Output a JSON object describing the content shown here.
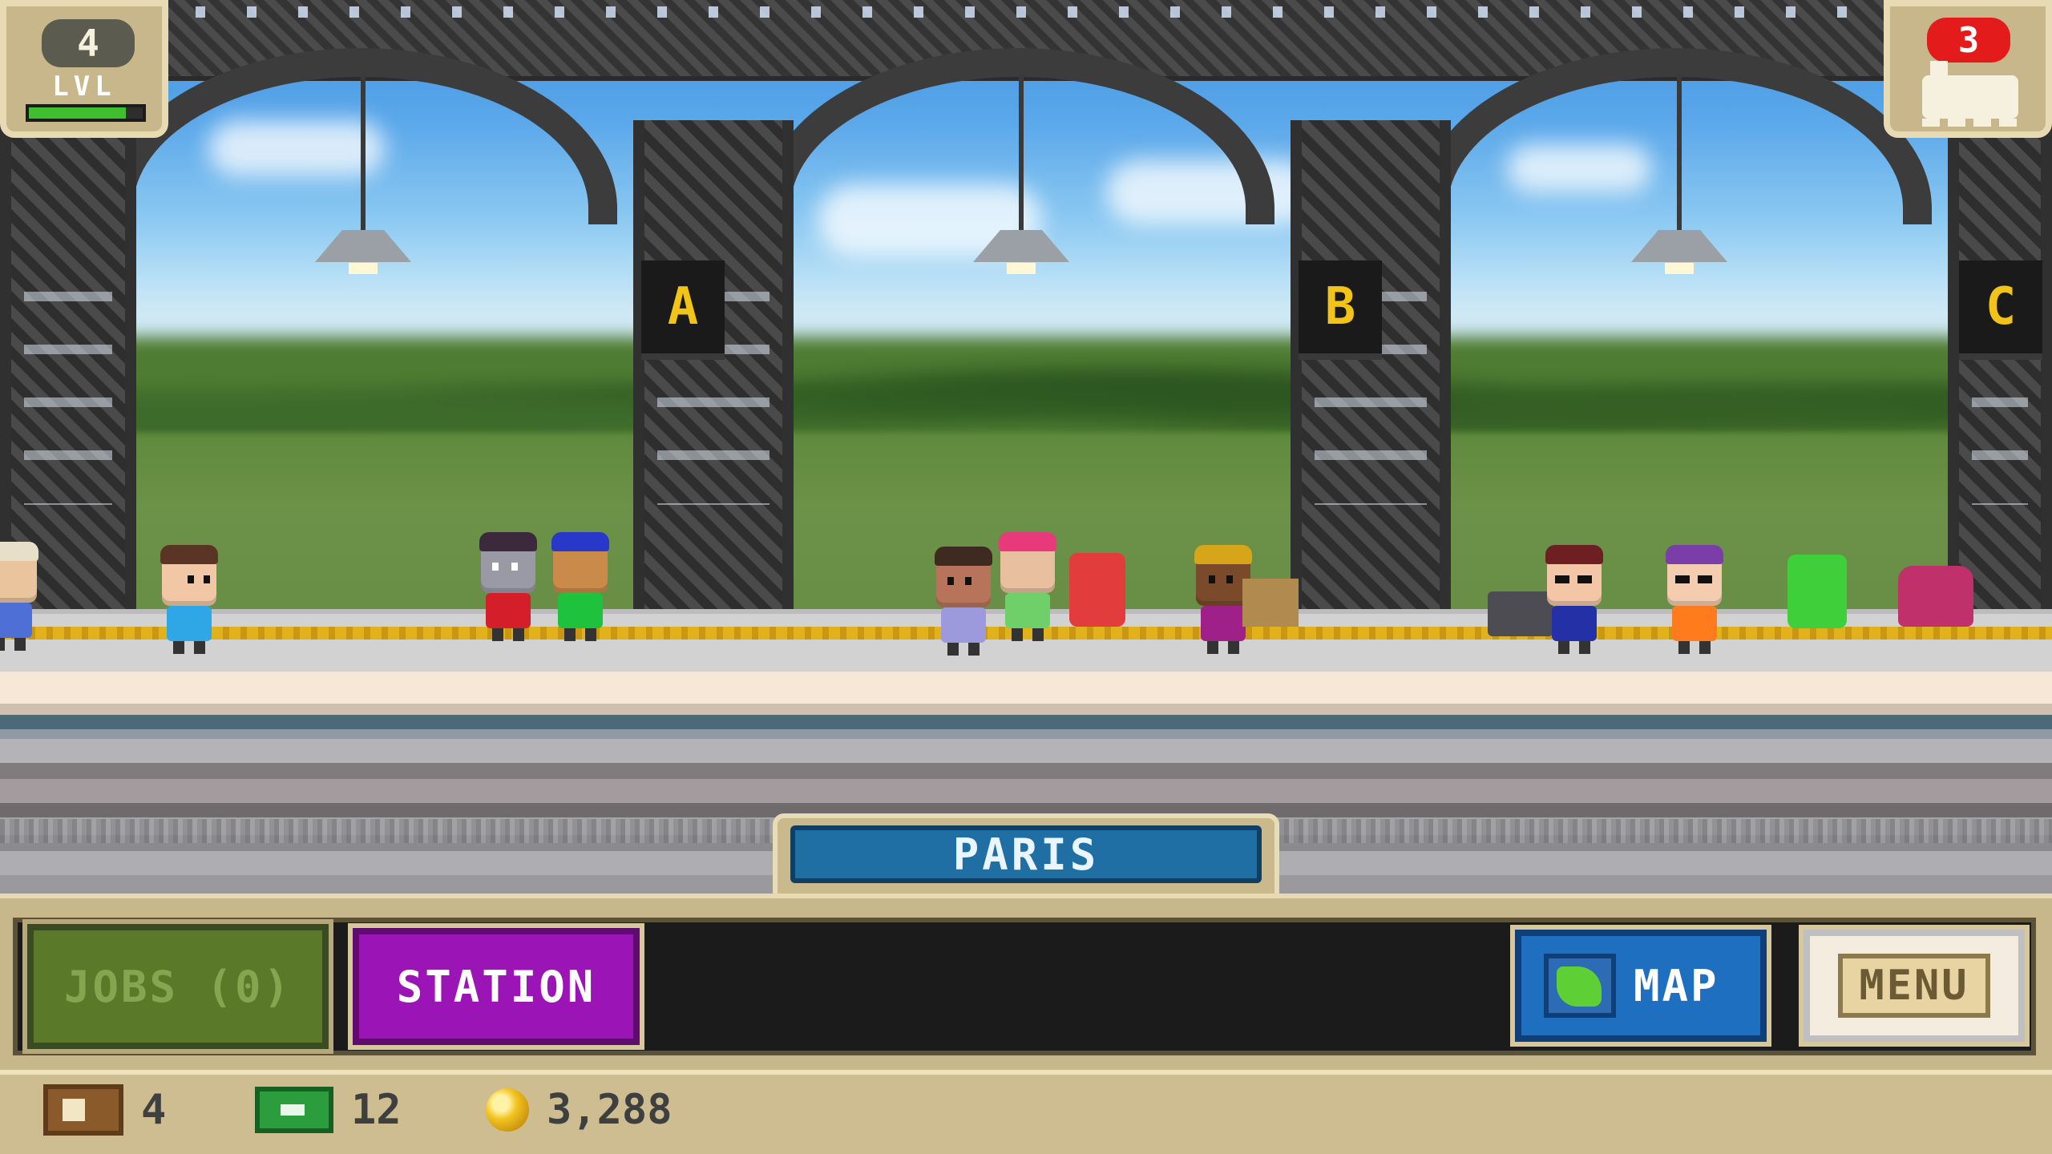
{
  "hud": {
    "level": "4",
    "level_label": "LVL",
    "xp_progress": 0.85,
    "trains_count": "3"
  },
  "platforms": {
    "a": "A",
    "b": "B",
    "c": "C"
  },
  "city": {
    "name": "PARIS"
  },
  "actions": {
    "jobs_label": "JOBS (0)",
    "station_label": "STATION",
    "map_label": "MAP",
    "menu_label": "MENU"
  },
  "resources": {
    "tickets": "4",
    "cash": "12",
    "coins": "3,288"
  },
  "icons": {
    "train": "train-icon",
    "map": "map-icon",
    "ticket": "ticket-icon",
    "cash": "cash-icon",
    "coin": "coin-icon"
  },
  "colors": {
    "station_button": "#9b14b6",
    "map_button": "#1f6fc0",
    "jobs_button": "#5a7a2a",
    "city_banner": "#1f6fa4",
    "trains_badge": "#e31b1b",
    "xp_fill": "#3fbf2f"
  }
}
